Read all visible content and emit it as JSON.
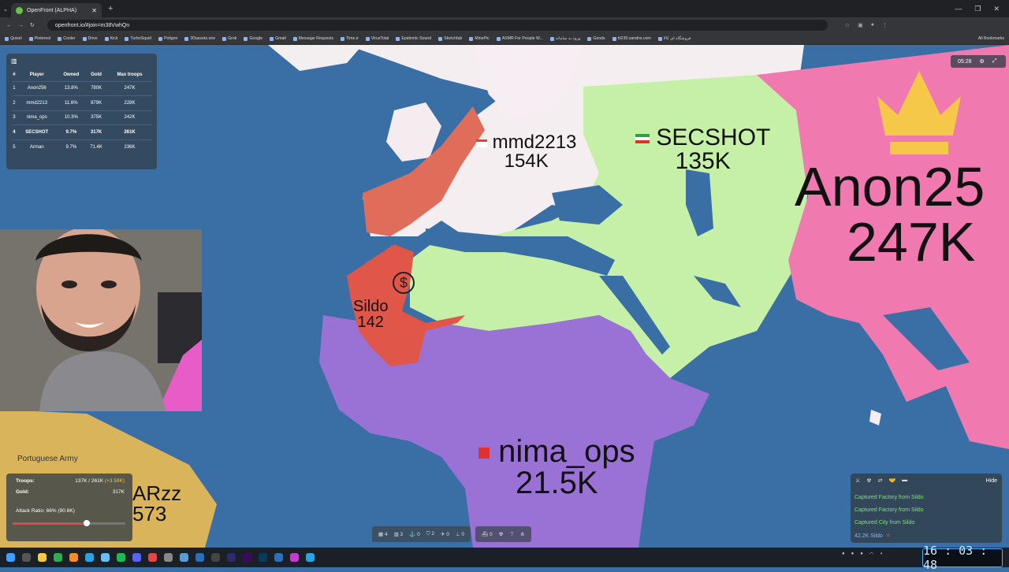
{
  "browser": {
    "tab_title": "OpenFront (ALPHA)",
    "url": "openfront.io/#join=m38VwhQn",
    "bookmarks": [
      "Quixel",
      "Pinterest",
      "Cooler",
      "Drive",
      "Kick",
      "TurboSquid",
      "Poligon",
      "3Dassets.one",
      "Grok",
      "Google",
      "Gmail",
      "Message Requests",
      "Time.ir",
      "VirusTotal",
      "Epidemic Sound",
      "Sketchfab",
      "MinePic",
      "ASMR For People W...",
      "ورود به سامانه",
      "Goods",
      "hl230.xandnx.com",
      "فروشگاه ای کالا"
    ],
    "all_bookmarks": "All Bookmarks"
  },
  "leaderboard": {
    "headers": [
      "#",
      "Player",
      "Owned",
      "Gold",
      "Max troops"
    ],
    "rows": [
      {
        "rank": "1",
        "player": "Anon256",
        "owned": "13.8%",
        "gold": "780K",
        "troops": "247K"
      },
      {
        "rank": "2",
        "player": "mmd2213",
        "owned": "11.6%",
        "gold": "879K",
        "troops": "228K"
      },
      {
        "rank": "3",
        "player": "nima_ops",
        "owned": "10.3%",
        "gold": "375K",
        "troops": "242K"
      },
      {
        "rank": "4",
        "player": "SECSHOT",
        "owned": "9.7%",
        "gold": "317K",
        "troops": "261K"
      },
      {
        "rank": "5",
        "player": "Arman",
        "owned": "9.7%",
        "gold": "71.4K",
        "troops": "236K"
      }
    ]
  },
  "map": {
    "players": [
      {
        "name": "mmd2213",
        "troops": "154K"
      },
      {
        "name": "SECSHOT",
        "troops": "135K"
      },
      {
        "name": "Anon25",
        "troops": "247K"
      },
      {
        "name": "Sildo",
        "troops": "142"
      },
      {
        "name": "nima_ops",
        "troops": "21.5K"
      }
    ],
    "other_labels": {
      "portuguese_army": "Portuguese Army",
      "arzz_name": "ARzz",
      "arzz_troops": "573"
    },
    "colors": {
      "ocean": "#3a6fa5",
      "mmd2213": "#e06d5a",
      "secshot": "#c6f0a8",
      "anon": "#f07ab0",
      "nima": "#9a72d6",
      "sildo": "#e0574a",
      "other": "#d9b45a"
    }
  },
  "timer": "05:28",
  "stats": {
    "troops_label": "Troops:",
    "troops_value": "137K / 261K",
    "troops_delta": "(+3.59K)",
    "gold_label": "Gold:",
    "gold_value": "317K",
    "attack_ratio": "Attack Ratio: 66% (90.6K)",
    "attack_ratio_pct": 66
  },
  "events": {
    "hide_label": "Hide",
    "items": [
      "Captured Factory from Sildo",
      "Captured Factory from Sildo",
      "Captured City from Sildo"
    ],
    "attack_amount": "42.2K Sildo"
  },
  "controls": {
    "values": [
      "4",
      "3",
      "0",
      "2",
      "0",
      "0",
      "0"
    ]
  },
  "clock": "16 : 03 : 48"
}
